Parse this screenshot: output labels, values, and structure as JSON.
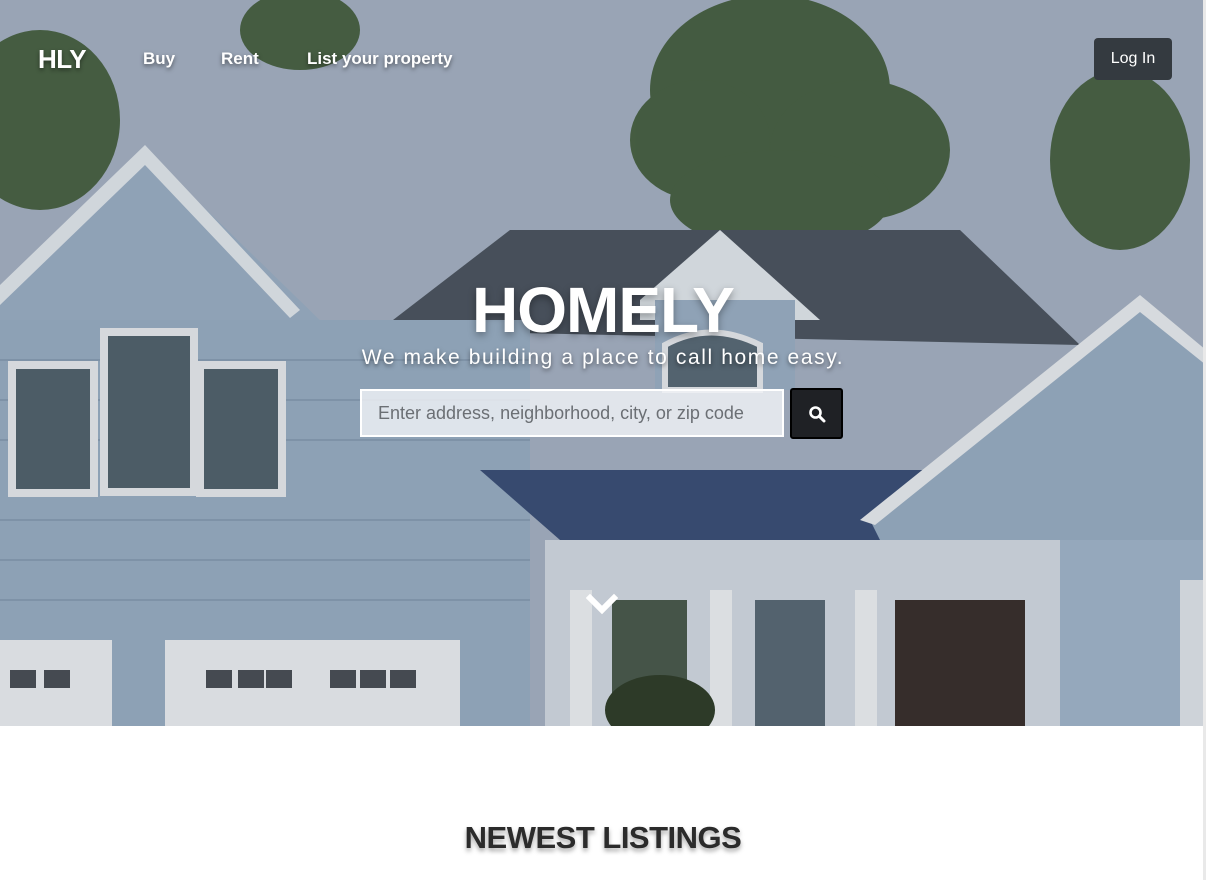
{
  "nav": {
    "brand": "HLY",
    "links": [
      "Buy",
      "Rent",
      "List your property"
    ],
    "login_label": "Log In"
  },
  "hero": {
    "title": "HOMELY",
    "subtitle": "We make building a place to call home easy.",
    "search_placeholder": "Enter address, neighborhood, city, or zip code",
    "search_icon": "search-icon",
    "scroll_icon": "chevron-down-icon"
  },
  "listings": {
    "heading": "NEWEST LISTINGS"
  },
  "colors": {
    "button_dark": "#343a40",
    "search_button": "#1f2125",
    "heading_text": "#2b2b2b"
  }
}
